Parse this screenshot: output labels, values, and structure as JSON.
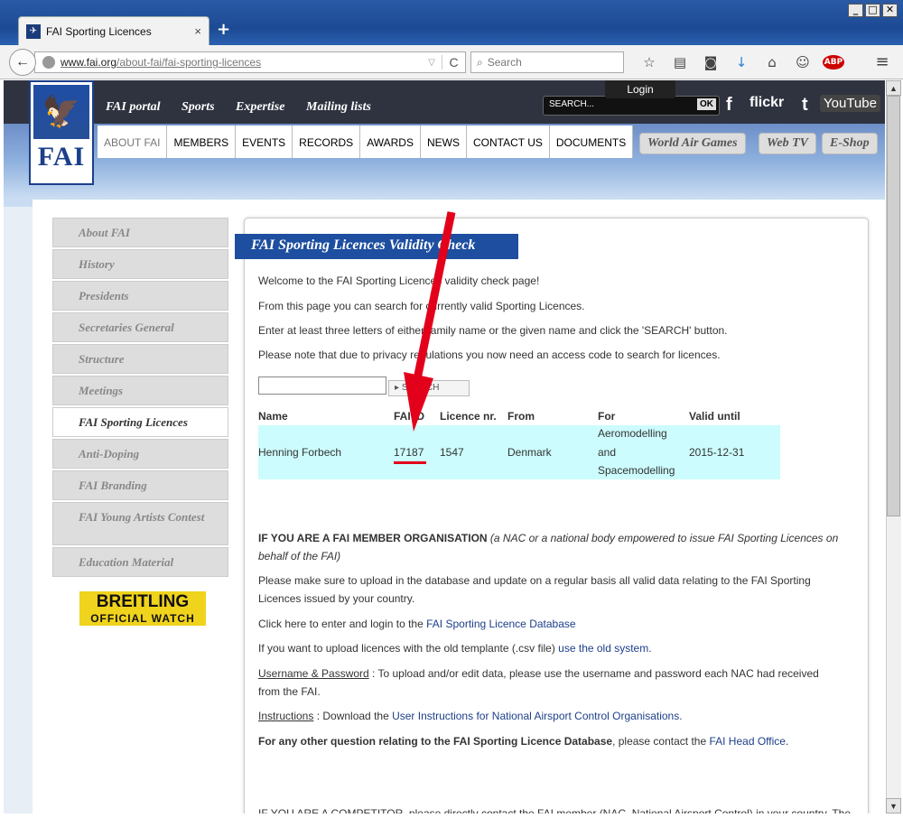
{
  "window": {
    "min": "_",
    "max": "□",
    "close": "✕"
  },
  "tab": {
    "favicon": "fai-favicon",
    "title": "FAI Sporting Licences",
    "close": "×",
    "new_tab": "+"
  },
  "nav": {
    "back": "←",
    "url_host": "www.fai.org",
    "url_path": "/about-fai/fai-sporting-licences",
    "dropdown": "▽",
    "reload": "C",
    "search_placeholder": "Search",
    "search_icon": "⌕"
  },
  "toolbar_icons": [
    "star-icon",
    "clipboard-icon",
    "pocket-icon",
    "download-icon",
    "home-icon",
    "chat-icon",
    "abp-icon",
    "menu-icon"
  ],
  "toolbar_glyphs": [
    "☆",
    "▤",
    "◙",
    "↓",
    "⌂",
    "☺",
    "ABP",
    "≡"
  ],
  "site": {
    "logo_text": "FAI",
    "top_links": [
      "FAI portal",
      "Sports",
      "Expertise",
      "Mailing lists"
    ],
    "search_placeholder": "SEARCH...",
    "search_ok": "OK",
    "login": "Login",
    "social": {
      "facebook": "f",
      "flickr": "flickr",
      "twitter": "t",
      "youtube": "YouTube"
    },
    "main_nav": [
      "ABOUT FAI",
      "MEMBERS",
      "EVENTS",
      "RECORDS",
      "AWARDS",
      "NEWS",
      "CONTACT US",
      "DOCUMENTS"
    ],
    "pills": [
      "World Air Games",
      "Web TV",
      "E-Shop"
    ]
  },
  "sidebar": [
    "About FAI",
    "History",
    "Presidents",
    "Secretaries General",
    "Structure",
    "Meetings",
    "FAI Sporting Licences",
    "Anti-Doping",
    "FAI Branding",
    "FAI Young Artists Contest",
    "Education Material"
  ],
  "sponsor": {
    "name": "BREITLING",
    "sub": "OFFICIAL WATCH"
  },
  "content": {
    "title": "FAI Sporting Licences Validity Check",
    "p1": "Welcome to the FAI Sporting Licences validity check page!",
    "p2": "From this page you can search for currently valid Sporting Licences.",
    "p3": "Enter at least three letters of either family name or the given name and click the 'SEARCH' button.",
    "p4": "Please note that due to privacy regulations you now need an access code to search for licences.",
    "search_button": "SEARCH",
    "table": {
      "headers": [
        "Name",
        "FAI ID",
        "Licence nr.",
        "From",
        "For",
        "Valid until"
      ],
      "row": {
        "name": "Henning Forbech",
        "fai_id": "17187",
        "licence": "1547",
        "from": "Denmark",
        "for1": "Aeromodelling",
        "for2": "and",
        "for3": "Spacemodelling",
        "valid": "2015-12-31"
      }
    },
    "member_heading": "IF YOU ARE A FAI MEMBER ORGANISATION",
    "member_note1": "(a NAC or a national body empowered to issue FAI Sporting Licences on",
    "member_note2": "behalf of the FAI)",
    "upload1": "Please make sure to upload in the database and update on a regular basis all valid data relating to the FAI Sporting",
    "upload2": "Licences issued by your country.",
    "click_here": "Click here to enter and login to the ",
    "db_link": "FAI Sporting Licence Database",
    "old_pre": "If you want to upload licences with the old templante (.csv file) ",
    "old_link": "use the old system.",
    "up_label": "Username & Password",
    "up_text1": " : To upload and/or edit data, please use the username and password each NAC had received",
    "up_text2": "from the FAI.",
    "instr_label": "Instructions",
    "instr_text": " : Download the ",
    "instr_link": "User Instructions for National Airsport Control Organisations.",
    "other_bold": "For any other question relating to the FAI Sporting Licence Database",
    "other_text": ", please contact the ",
    "other_link": "FAI Head Office",
    "other_end": ".",
    "cut_line": "IF YOU ARE A COMPETITOR, please directly contact the FAI member (NAC, National Airsport Control) in your country. The"
  },
  "scroll": {
    "up": "▲",
    "down": "▼"
  },
  "colors": {
    "annotation": "#e3001b",
    "highlight_row": "#ccfcfd",
    "title_bg": "#1d4ea0",
    "link": "#1d3f8a"
  }
}
